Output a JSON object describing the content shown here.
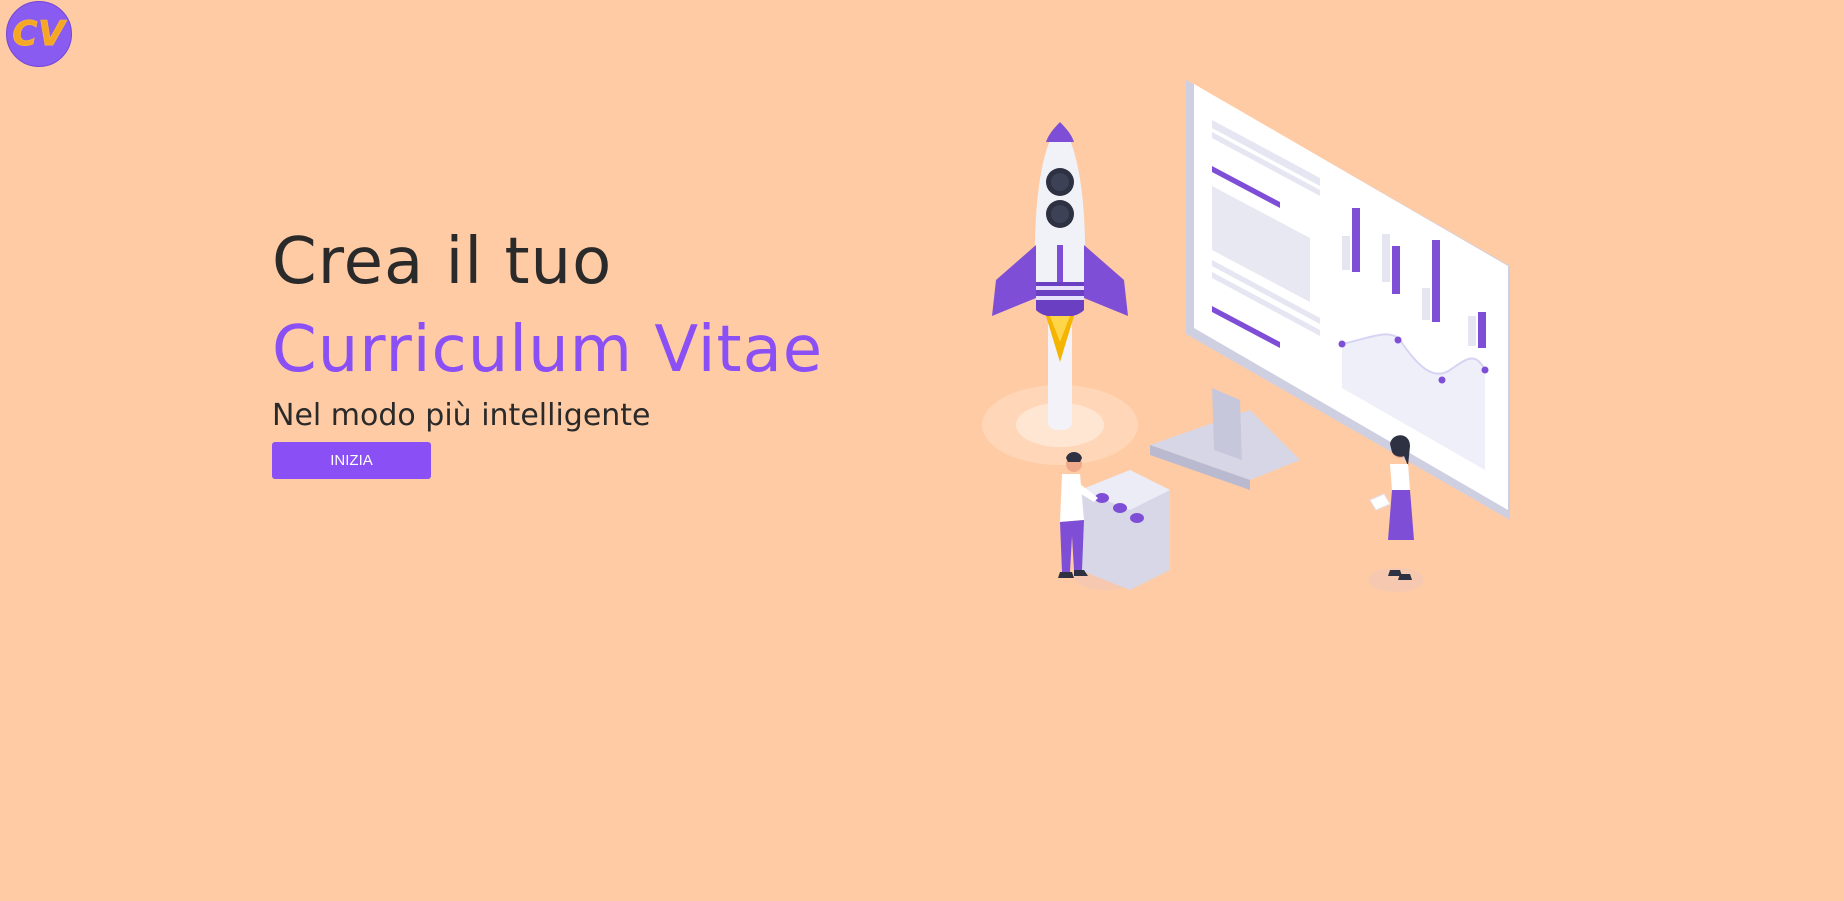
{
  "logo": {
    "text": "CV"
  },
  "hero": {
    "title_line1": "Crea il tuo",
    "title_line2": "Curriculum Vitae",
    "subtitle": "Nel modo più intelligente",
    "cta_label": "INIZIA"
  },
  "colors": {
    "background": "#ffcba4",
    "accent": "#8a4ff5",
    "logo_text": "#f5a623"
  },
  "illustration": {
    "icons": [
      "rocket-icon",
      "monitor-dashboard-icon",
      "person-at-console-icon",
      "person-with-paper-icon"
    ]
  }
}
